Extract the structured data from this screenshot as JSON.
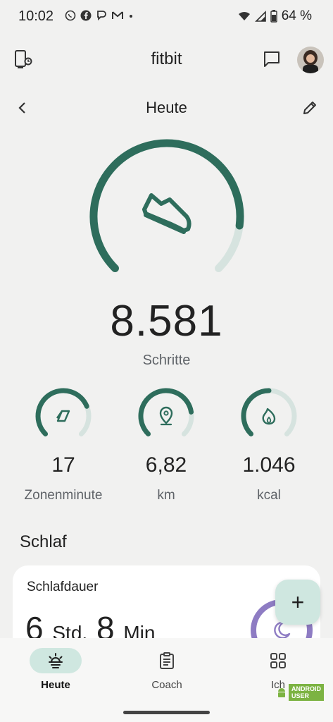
{
  "status_bar": {
    "time": "10:02",
    "battery": "64 %",
    "notification_icons": [
      "whatsapp-icon",
      "facebook-icon",
      "messenger-icon",
      "gmail-icon",
      "dot-icon"
    ]
  },
  "app_bar": {
    "title": "fitbit",
    "left_icon": "device-sync-icon",
    "right_icons": [
      "message-icon",
      "avatar"
    ]
  },
  "sub_bar": {
    "title": "Heute",
    "back_icon": "chevron-left-icon",
    "edit_icon": "pencil-icon"
  },
  "steps": {
    "value": "8.581",
    "label": "Schritte",
    "progress": 0.86,
    "icon": "shoe-icon"
  },
  "stats": [
    {
      "value": "17",
      "label": "Zonenminute",
      "icon": "zone-arrow-icon",
      "progress": 0.75
    },
    {
      "value": "6,82",
      "label": "km",
      "icon": "location-pin-icon",
      "progress": 0.8
    },
    {
      "value": "1.046",
      "label": "kcal",
      "icon": "flame-icon",
      "progress": 0.5
    }
  ],
  "sleep_section": {
    "title": "Schlaf",
    "card_title": "Schlafdauer",
    "hours": "6",
    "hours_unit": "Std.",
    "minutes": "8",
    "minutes_unit": "Min"
  },
  "fab": {
    "label": "+"
  },
  "bottom_nav": [
    {
      "label": "Heute",
      "icon": "sunrise-icon",
      "active": true
    },
    {
      "label": "Coach",
      "icon": "clipboard-icon",
      "active": false
    },
    {
      "label": "Ich",
      "icon": "grid-icon",
      "active": false
    }
  ],
  "watermark": {
    "line1": "ANDROID",
    "line2": "USER"
  },
  "colors": {
    "accent": "#2e6d5c",
    "accent_light": "#d6e3df",
    "background": "#f1f1f0",
    "card": "#ffffff",
    "pill": "#cfe7e0",
    "sleep_ring": "#8e7cc3"
  }
}
